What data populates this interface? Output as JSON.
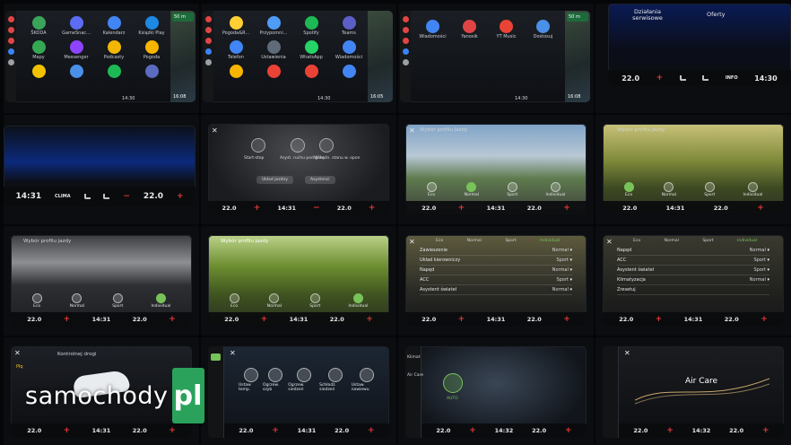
{
  "aa": {
    "rail_colors": [
      "#e04545",
      "#e04545",
      "#e04545",
      "#3b82f6",
      "#9aa0a6"
    ],
    "screen1": [
      {
        "label": "ŠKODA",
        "color": "#3aa55a"
      },
      {
        "label": "GameSnac...",
        "color": "#5b6df5"
      },
      {
        "label": "Kalendarz",
        "color": "#4285f4"
      },
      {
        "label": "Książki Play",
        "color": "#1e88e5"
      },
      {
        "label": "Mapy",
        "color": "#34a853"
      },
      {
        "label": "Messenger",
        "color": "#8e44ff"
      },
      {
        "label": "Podcasty",
        "color": "#f2b705"
      },
      {
        "label": "Pogoda",
        "color": "#f7b500"
      },
      {
        "label": "",
        "color": "#f2c200"
      },
      {
        "label": "",
        "color": "#4a8fe8"
      },
      {
        "label": "",
        "color": "#1db954"
      },
      {
        "label": "",
        "color": "#5c6bc0"
      }
    ],
    "screen1_time": "14:30",
    "screen1_map_time": "16:08",
    "screen1_nav": "50 m",
    "screen2": [
      {
        "label": "Pogoda&R...",
        "color": "#ffcf33"
      },
      {
        "label": "Przypomni...",
        "color": "#4f9cf7"
      },
      {
        "label": "Spotify",
        "color": "#1db954"
      },
      {
        "label": "Teams",
        "color": "#5b5fc7"
      },
      {
        "label": "Telefon",
        "color": "#4285f4"
      },
      {
        "label": "Ustawienia",
        "color": "#5f6b78"
      },
      {
        "label": "WhatsApp",
        "color": "#25d366"
      },
      {
        "label": "Wiadomości",
        "color": "#4285f4"
      },
      {
        "label": "",
        "color": "#f7b500"
      },
      {
        "label": "",
        "color": "#ea4335"
      },
      {
        "label": "",
        "color": "#ea4335"
      },
      {
        "label": "",
        "color": "#4285f4"
      }
    ],
    "screen2_time": "14:30",
    "screen2_map_time": "16:05",
    "screen3": [
      {
        "label": "Wiadomości",
        "color": "#4285f4"
      },
      {
        "label": "Yanosik",
        "color": "#e04545"
      },
      {
        "label": "YT Music",
        "color": "#ea4335"
      },
      {
        "label": "Dostosuj",
        "color": "#4a8fe8"
      }
    ],
    "screen3_time": "14:30",
    "screen3_map_time": "16:08",
    "screen3_nav": "50 m"
  },
  "top_right": {
    "left_label": "Działania serwisowe",
    "right_label": "Oferty",
    "temp_left": "22.0",
    "info": "INFO",
    "time": "14:30"
  },
  "climate_row2a": {
    "time": "14:31",
    "mode": "CLIMA",
    "temp": "22.0"
  },
  "drive_menu": {
    "items": [
      "Start-stop",
      "Asyst. ruchu pod górę",
      "Wskaźn. stanu w. opon"
    ],
    "buttons": [
      "Układ jezdny",
      "Asystenci"
    ]
  },
  "profile_title": "Wybór profilu jazdy",
  "profiles": [
    "Eco",
    "Normal",
    "Sport",
    "Individual"
  ],
  "climate_bar": {
    "temp_left": "22.0",
    "time": "14:31",
    "temp_right": "22.0"
  },
  "individual_tabs": [
    "Eco",
    "Normal",
    "Sport",
    "Individual"
  ],
  "individual_rows_a": [
    {
      "name": "Zawieszenie",
      "value": "Normal"
    },
    {
      "name": "Układ kierowniczy",
      "value": "Sport"
    },
    {
      "name": "Napęd",
      "value": "Normal"
    },
    {
      "name": "ACC",
      "value": "Sport"
    },
    {
      "name": "Asystent świateł",
      "value": "Normal"
    }
  ],
  "individual_rows_b": [
    {
      "name": "Napęd",
      "value": "Normal"
    },
    {
      "name": "ACC",
      "value": "Sport"
    },
    {
      "name": "Asystent świateł",
      "value": "Sport"
    },
    {
      "name": "Klimatyzacja",
      "value": "Normal"
    },
    {
      "name": "Zresetuj",
      "value": ""
    }
  ],
  "bottom": {
    "traffic_title": "Kontrolnej drogi",
    "traffic_value": "Płq",
    "climate_items": [
      "Ustaw temp.",
      "Ogrzew. szyb",
      "Ogrzew. siedzeń",
      "Schładz. siedzeń",
      "Ustaw. nawiewu"
    ],
    "auto_label": "AUTO",
    "side_labels": [
      "Klimat",
      "Air Care"
    ],
    "time": "14:32",
    "aircare_title": "Air Care"
  },
  "watermark": {
    "text": "samochody",
    "badge": "pl"
  }
}
